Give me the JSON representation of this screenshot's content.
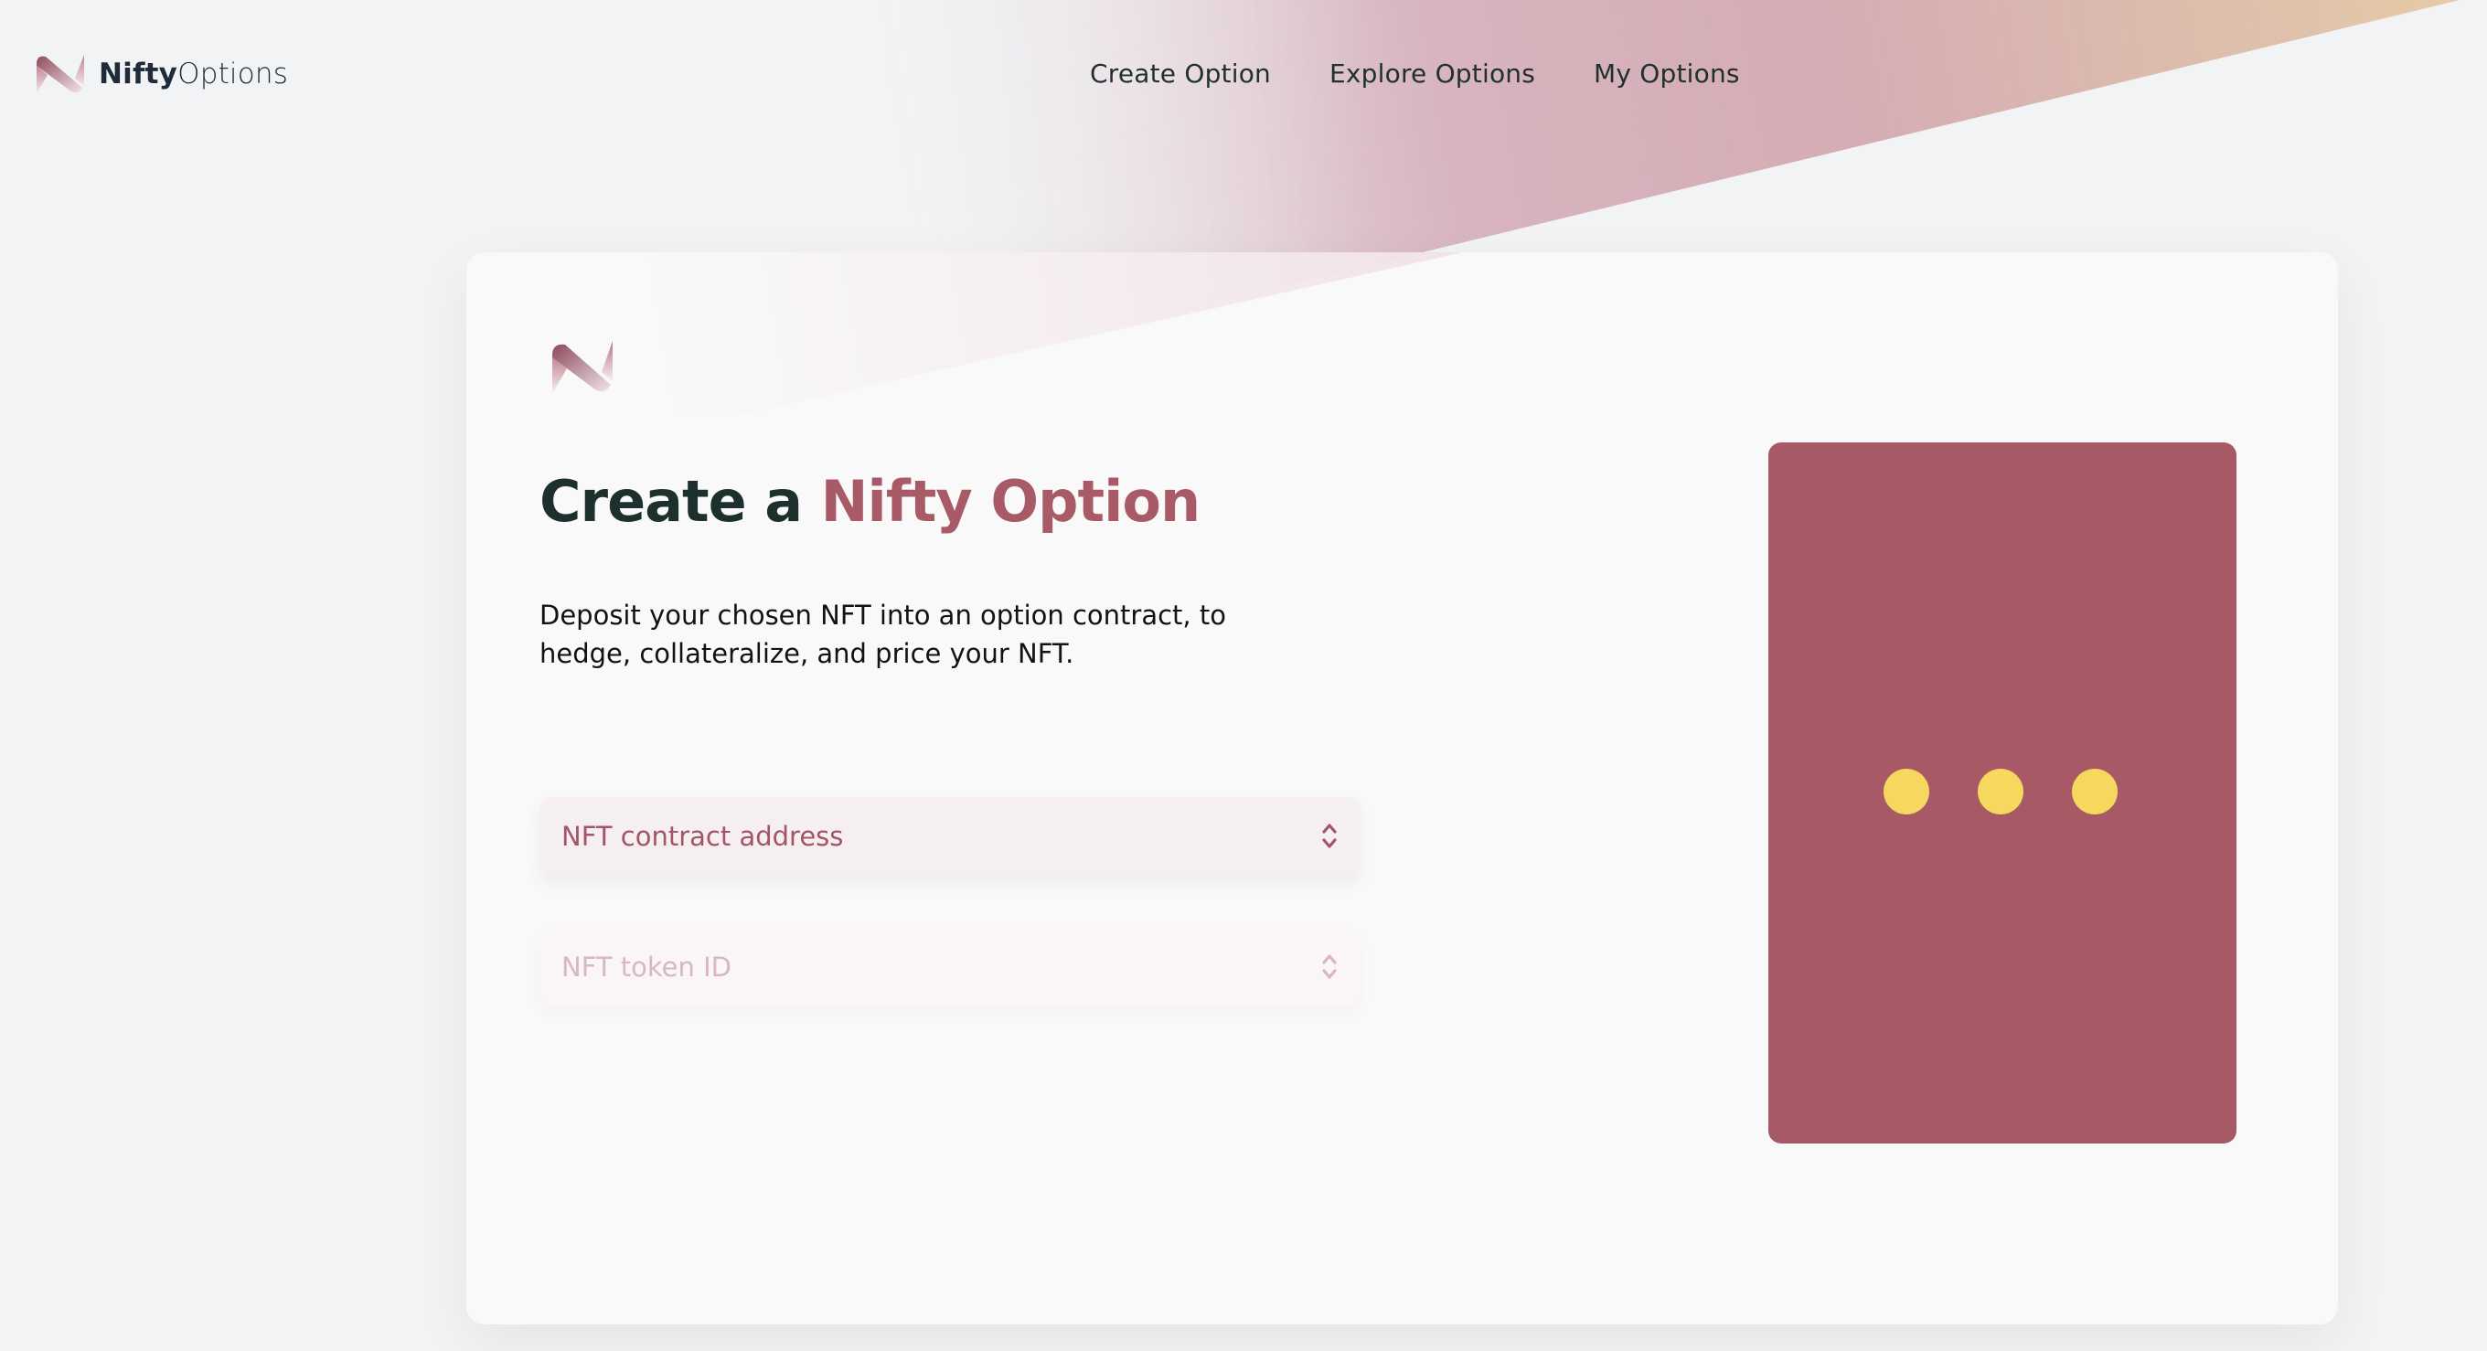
{
  "brand": {
    "name_bold": "Nifty",
    "name_light": "Options"
  },
  "nav": {
    "items": [
      {
        "label": "Create Option"
      },
      {
        "label": "Explore Options"
      },
      {
        "label": "My Options"
      }
    ]
  },
  "main": {
    "title_prefix": "Create a",
    "title_accent": "Nifty Option",
    "description": "Deposit your chosen NFT into an option contract, to hedge, collateralize, and price your NFT.",
    "fields": [
      {
        "placeholder": "NFT contract address",
        "state": "enabled"
      },
      {
        "placeholder": "NFT token ID",
        "state": "disabled"
      }
    ]
  },
  "preview": {
    "state": "loading",
    "indicator": "three-dots"
  },
  "colors": {
    "accent": "#a85a66",
    "preview_bg": "#a75a66",
    "loading_dot": "#f6d85e",
    "heading": "#1d302d",
    "gradient_start": "#c993a2",
    "gradient_end": "#e4c9a2"
  }
}
